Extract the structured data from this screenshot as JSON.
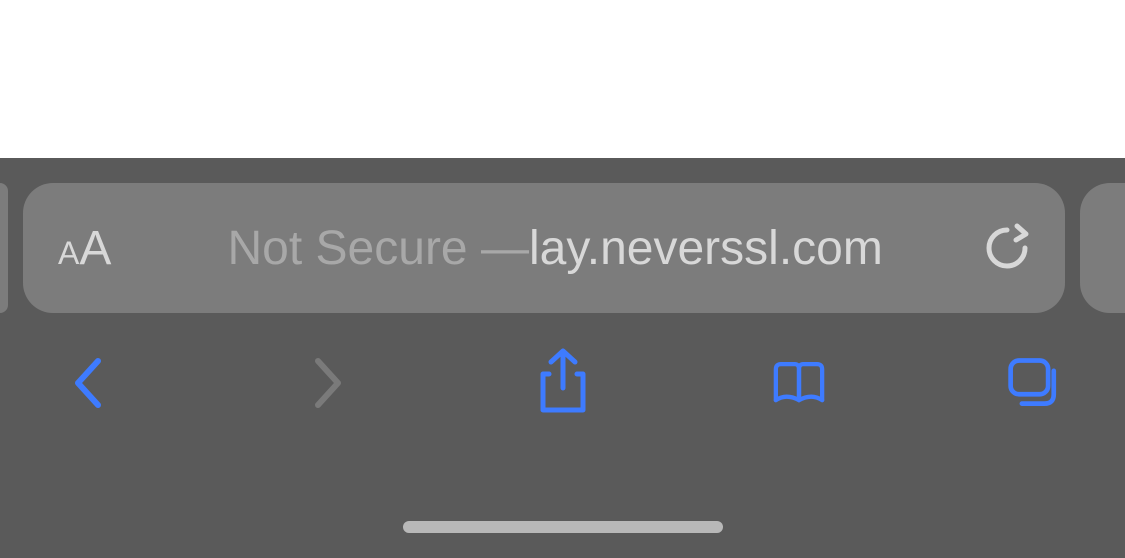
{
  "addressBar": {
    "aaLabel": "AA",
    "securityStatus": "Not Secure — ",
    "domain": "lay.neverssl.com"
  },
  "icons": {
    "textSize": "text-size-aa",
    "reload": "reload",
    "back": "back",
    "forward": "forward",
    "share": "share",
    "bookmarks": "bookmarks",
    "tabs": "tabs"
  }
}
